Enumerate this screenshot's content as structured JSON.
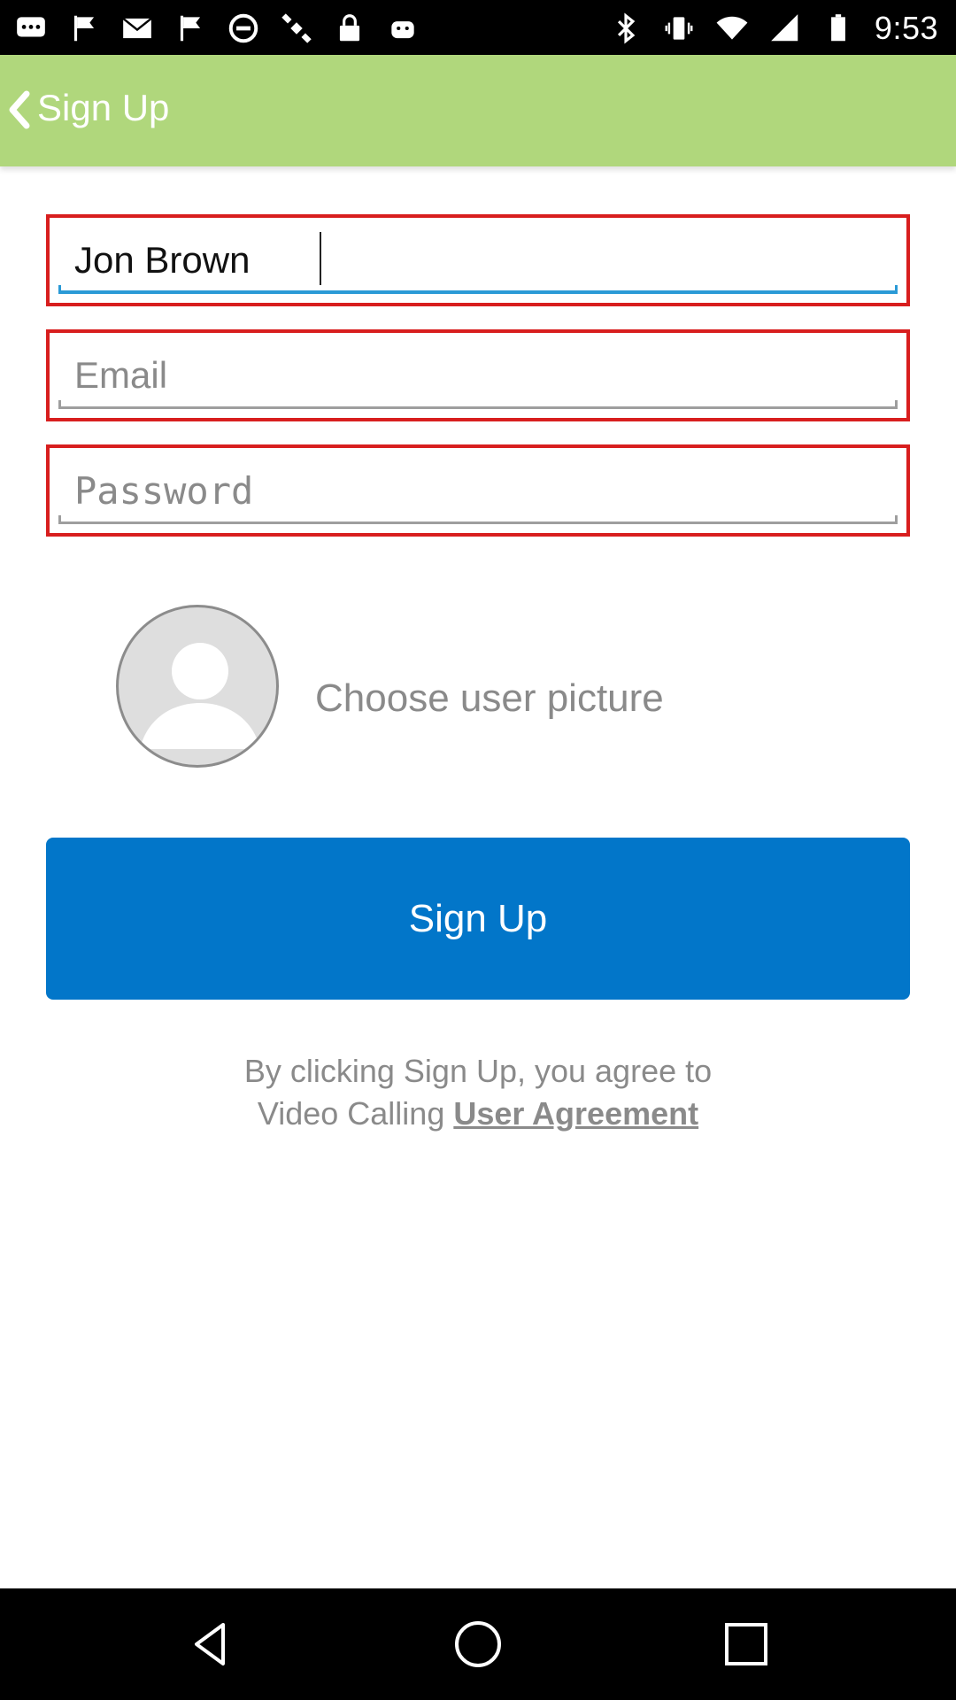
{
  "status_bar": {
    "time": "9:53",
    "left_icons": [
      "messages-icon",
      "flag-icon",
      "mail-icon",
      "flag-icon",
      "blocked-icon",
      "satellite-icon",
      "lock-icon",
      "android-icon"
    ],
    "right_icons": [
      "bluetooth-icon",
      "vibrate-icon",
      "wifi-icon",
      "signal-icon",
      "battery-icon"
    ]
  },
  "action_bar": {
    "title": "Sign Up",
    "background": "#b0d77c"
  },
  "form": {
    "name_value": "Jon Brown",
    "email_placeholder": "Email",
    "password_placeholder": "Password",
    "error_border_color": "#d81e1e",
    "focus_color": "#2a9ad6"
  },
  "picture": {
    "label": "Choose user picture",
    "icon": "avatar-placeholder-icon"
  },
  "signup_button": {
    "label": "Sign Up",
    "color": "#0276c9"
  },
  "agreement": {
    "line1": "By clicking Sign Up, you agree to",
    "line2_prefix": "Video Calling ",
    "link": "User Agreement"
  },
  "nav_bar": {
    "buttons": [
      "back-icon",
      "home-icon",
      "recents-icon"
    ]
  }
}
